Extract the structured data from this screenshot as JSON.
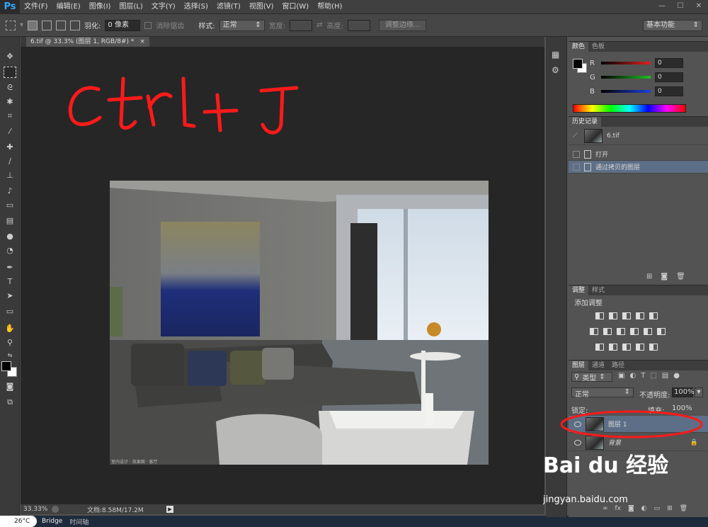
{
  "app": {
    "logo": "Ps",
    "menu": [
      "文件(F)",
      "编辑(E)",
      "图像(I)",
      "图层(L)",
      "文字(Y)",
      "选择(S)",
      "滤镜(T)",
      "视图(V)",
      "窗口(W)",
      "帮助(H)"
    ],
    "window_controls": [
      "—",
      "☐",
      "✕"
    ]
  },
  "options_bar": {
    "feather_label": "羽化:",
    "feather_value": "0 像素",
    "antialias_label": "消除锯齿",
    "style_label": "样式:",
    "style_value": "正常",
    "width_label": "宽度:",
    "height_label": "高度:",
    "refine_edge_button": "调整边缘...",
    "workspace_value": "基本功能"
  },
  "document": {
    "tab_title": "6.tif @ 33.3% (图层 1, RGB/8#) *",
    "tab_close": "×",
    "annotation_text": "ctrl+J",
    "watermark": "室内设计 · 效果图 · 客厅"
  },
  "status": {
    "zoom": "33.33%",
    "doc_info": "文档:8.58M/17.2M"
  },
  "taskbar": {
    "temperature": "26°C",
    "tabs": [
      "Bridge",
      "时间轴"
    ]
  },
  "color_panel": {
    "tabs": [
      "颜色",
      "色板"
    ],
    "channels": [
      {
        "label": "R",
        "value": "0",
        "color": "#e02020"
      },
      {
        "label": "G",
        "value": "0",
        "color": "#20c020"
      },
      {
        "label": "B",
        "value": "0",
        "color": "#2040e0"
      }
    ]
  },
  "history_panel": {
    "tabs": [
      "历史记录"
    ],
    "snapshot": "6.tif",
    "items": [
      "打开",
      "通过拷贝的图层"
    ]
  },
  "adjust_panel": {
    "tabs": [
      "调整",
      "样式"
    ],
    "title": "添加调整"
  },
  "layers_panel": {
    "tabs": [
      "图层",
      "通道",
      "路径"
    ],
    "filter_label": "类型",
    "blend_mode": "正常",
    "opacity_label": "不透明度:",
    "opacity_value": "100%",
    "lock_label": "锁定:",
    "fill_label": "填充:",
    "fill_value": "100%",
    "layers": [
      {
        "name": "图层 1",
        "selected": true
      },
      {
        "name": "背景",
        "selected": false,
        "locked": true
      }
    ]
  },
  "baidu": {
    "logo": "Bai du 经验",
    "url": "jingyan.baidu.com"
  },
  "colors": {
    "annotation_red": "#ff1a1a",
    "selection_blue": "#5d6f86"
  }
}
